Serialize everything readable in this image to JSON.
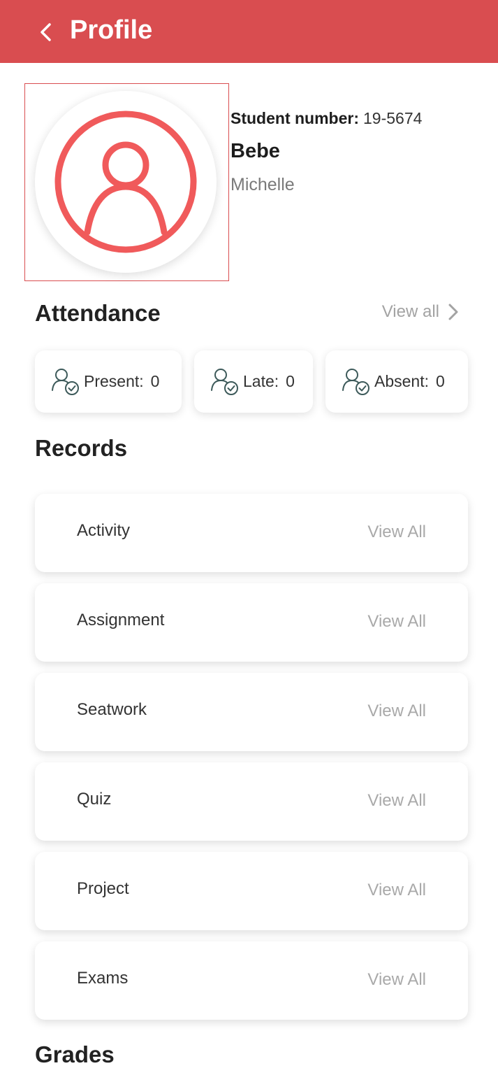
{
  "appbar": {
    "title": "Profile",
    "color": "#d94d50"
  },
  "profile": {
    "student_number_label": "Student number:",
    "student_number": "19-5674",
    "last_name": "Bebe",
    "first_name": "Michelle",
    "avatar_icon": "user-circle-icon",
    "avatar_color": "#f05a5b"
  },
  "attendance": {
    "title": "Attendance",
    "view_all": "View all",
    "items": [
      {
        "label": "Present:",
        "value": "0",
        "icon": "user-check-icon"
      },
      {
        "label": "Late:",
        "value": "0",
        "icon": "user-check-icon"
      },
      {
        "label": "Absent:",
        "value": "0",
        "icon": "user-check-icon"
      }
    ]
  },
  "records": {
    "title": "Records",
    "items": [
      {
        "label": "Activity",
        "action": "View All"
      },
      {
        "label": "Assignment",
        "action": "View All"
      },
      {
        "label": "Seatwork",
        "action": "View All"
      },
      {
        "label": "Quiz",
        "action": "View All"
      },
      {
        "label": "Project",
        "action": "View All"
      },
      {
        "label": "Exams",
        "action": "View All"
      }
    ]
  },
  "grades": {
    "title": "Grades"
  }
}
